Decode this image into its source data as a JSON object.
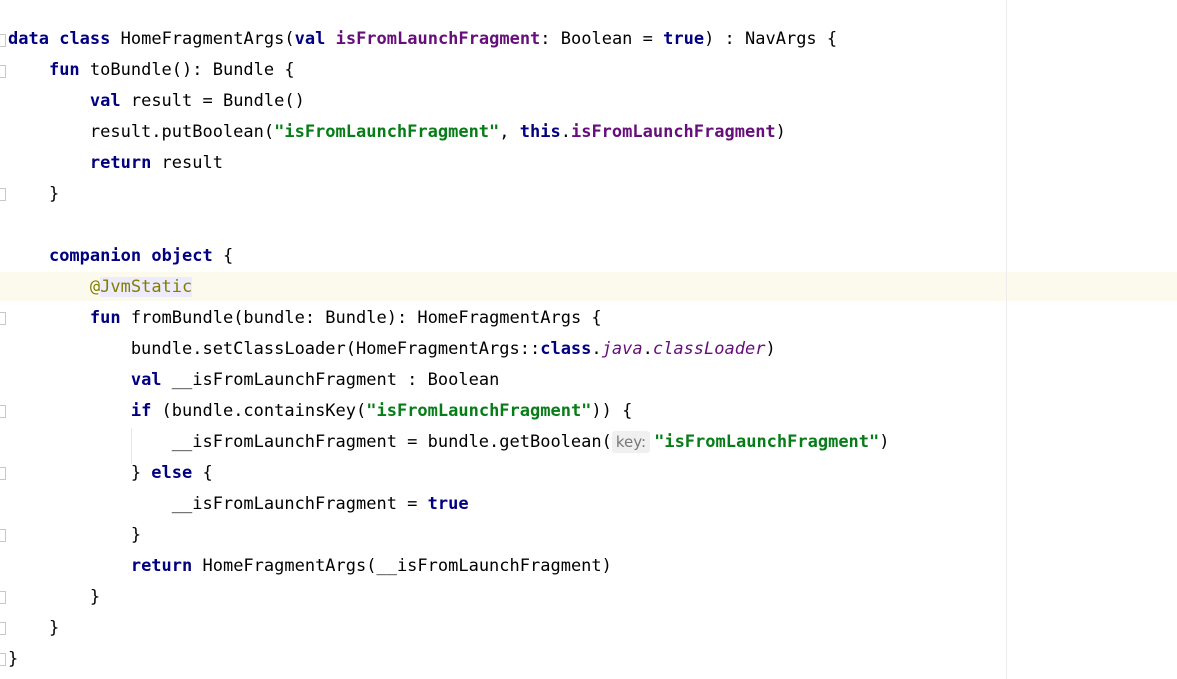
{
  "editor": {
    "language": "Kotlin",
    "code_lines": [
      [
        {
          "t": "data",
          "c": "kw"
        },
        {
          "t": " "
        },
        {
          "t": "class",
          "c": "kw"
        },
        {
          "t": " HomeFragmentArgs("
        },
        {
          "t": "val",
          "c": "kw"
        },
        {
          "t": " "
        },
        {
          "t": "isFromLaunchFragment",
          "c": "prop"
        },
        {
          "t": ": Boolean = "
        },
        {
          "t": "true",
          "c": "kw"
        },
        {
          "t": ") : NavArgs {"
        }
      ],
      [
        {
          "t": "    "
        },
        {
          "t": "fun",
          "c": "kw"
        },
        {
          "t": " toBundle(): Bundle {"
        }
      ],
      [
        {
          "t": "        "
        },
        {
          "t": "val",
          "c": "kw"
        },
        {
          "t": " result = Bundle()"
        }
      ],
      [
        {
          "t": "        result.putBoolean("
        },
        {
          "t": "\"isFromLaunchFragment\"",
          "c": "str"
        },
        {
          "t": ", "
        },
        {
          "t": "this",
          "c": "kw"
        },
        {
          "t": "."
        },
        {
          "t": "isFromLaunchFragment",
          "c": "prop"
        },
        {
          "t": ")"
        }
      ],
      [
        {
          "t": "        "
        },
        {
          "t": "return",
          "c": "kw"
        },
        {
          "t": " result"
        }
      ],
      [
        {
          "t": "    }"
        }
      ],
      [],
      [
        {
          "t": "    "
        },
        {
          "t": "companion",
          "c": "kw"
        },
        {
          "t": " "
        },
        {
          "t": "object",
          "c": "kw"
        },
        {
          "t": " {"
        }
      ],
      [
        {
          "t": "        "
        },
        {
          "t": "@",
          "c": "anno"
        },
        {
          "t": "JvmStatic",
          "c": "anno jvm"
        }
      ],
      [
        {
          "t": "        "
        },
        {
          "t": "fun",
          "c": "kw"
        },
        {
          "t": " fromBundle(bundle: Bundle): HomeFragmentArgs {"
        }
      ],
      [
        {
          "t": "            bundle.setClassLoader(HomeFragmentArgs::"
        },
        {
          "t": "class",
          "c": "kw"
        },
        {
          "t": "."
        },
        {
          "t": "java",
          "c": "it"
        },
        {
          "t": "."
        },
        {
          "t": "classLoader",
          "c": "it"
        },
        {
          "t": ")"
        }
      ],
      [
        {
          "t": "            "
        },
        {
          "t": "val",
          "c": "kw"
        },
        {
          "t": " __isFromLaunchFragment : Boolean"
        }
      ],
      [
        {
          "t": "            "
        },
        {
          "t": "if",
          "c": "kw"
        },
        {
          "t": " (bundle.containsKey("
        },
        {
          "t": "\"isFromLaunchFragment\"",
          "c": "str"
        },
        {
          "t": ")) {"
        }
      ],
      [
        {
          "t": "                __isFromLaunchFragment = bundle.getBoolean("
        },
        {
          "t": "key:",
          "c": "hint"
        },
        {
          "t": "\"isFromLaunchFragment\"",
          "c": "str"
        },
        {
          "t": ")"
        }
      ],
      [
        {
          "t": "            } "
        },
        {
          "t": "else",
          "c": "kw"
        },
        {
          "t": " {"
        }
      ],
      [
        {
          "t": "                __isFromLaunchFragment = "
        },
        {
          "t": "true",
          "c": "kw"
        }
      ],
      [
        {
          "t": "            }"
        }
      ],
      [
        {
          "t": "            "
        },
        {
          "t": "return",
          "c": "kw"
        },
        {
          "t": " HomeFragmentArgs(__isFromLaunchFragment)"
        }
      ],
      [
        {
          "t": "        }"
        }
      ],
      [
        {
          "t": "    }"
        }
      ],
      [
        {
          "t": "}"
        }
      ]
    ],
    "colors": {
      "keyword": "#000080",
      "property": "#660e7a",
      "string": "#067d17",
      "annotation": "#808000",
      "caret_row": "#fcfaed"
    }
  }
}
